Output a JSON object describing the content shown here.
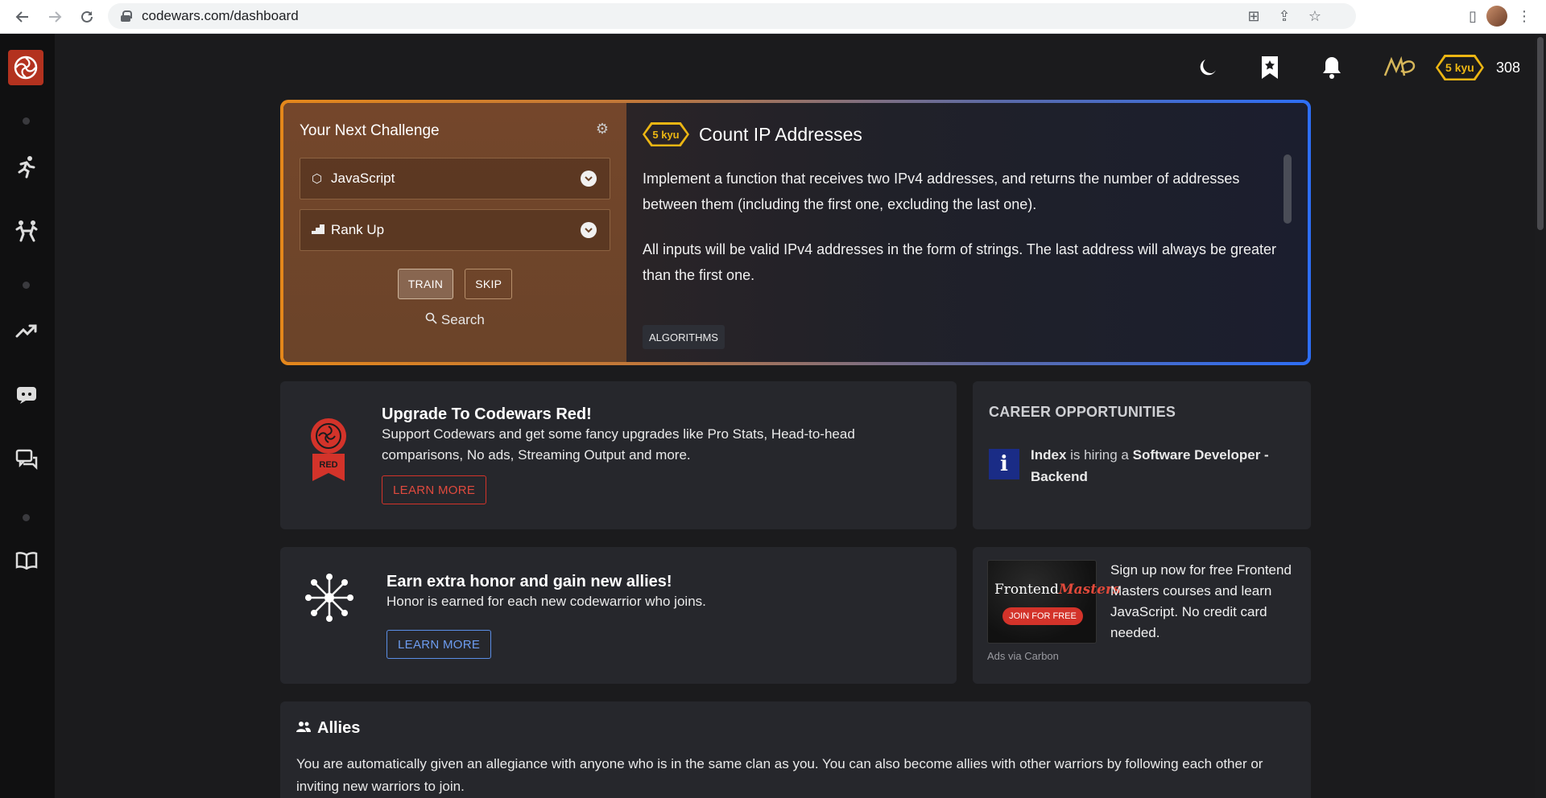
{
  "browser": {
    "url": "codewars.com/dashboard",
    "back_icon": "arrow-left-icon",
    "forward_icon": "arrow-right-icon",
    "reload_icon": "reload-icon"
  },
  "header": {
    "rank": "5 kyu",
    "honor": "308"
  },
  "challenge": {
    "title": "Your Next Challenge",
    "language": "JavaScript",
    "strategy": "Rank Up",
    "train_label": "TRAIN",
    "skip_label": "SKIP",
    "search_label": "Search",
    "kata_rank": "5 kyu",
    "kata_name": "Count IP Addresses",
    "description_1": "Implement a function that receives two IPv4 addresses, and returns the number of addresses between them (including the first one, excluding the last one).",
    "description_2": "All inputs will be valid IPv4 addresses in the form of strings. The last address will always be greater than the first one.",
    "tag": "ALGORITHMS"
  },
  "upgrade": {
    "title": "Upgrade To Codewars Red!",
    "body": "Support Codewars and get some fancy upgrades like Pro Stats, Head-to-head comparisons, No ads, Streaming Output and more.",
    "button": "LEARN MORE",
    "badge_text": "RED"
  },
  "career": {
    "title": "CAREER OPPORTUNITIES",
    "company": "Index",
    "hiring_text": " is hiring a ",
    "role": "Software Developer - Backend",
    "logo_letter": "i"
  },
  "honor_card": {
    "title": "Earn extra honor and gain new allies!",
    "body": "Honor is earned for each new codewarrior who joins.",
    "button": "LEARN MORE"
  },
  "ad": {
    "brand_plain": "Frontend",
    "brand_accent": "Masters",
    "cta": "JOIN FOR FREE",
    "text": "Sign up now for free Frontend Masters courses and learn JavaScript. No credit card needed.",
    "via": "Ads via Carbon"
  },
  "allies": {
    "title": "Allies",
    "body": "You are automatically given an allegiance with anyone who is in the same clan as you. You can also become allies with other warriors by following each other or inviting new warriors to join."
  },
  "colors": {
    "accent_orange": "#e4871b",
    "accent_blue": "#2d6ef6",
    "kyu_yellow": "#ecb613",
    "red": "#d3332a",
    "link_blue": "#5b8ee6"
  }
}
